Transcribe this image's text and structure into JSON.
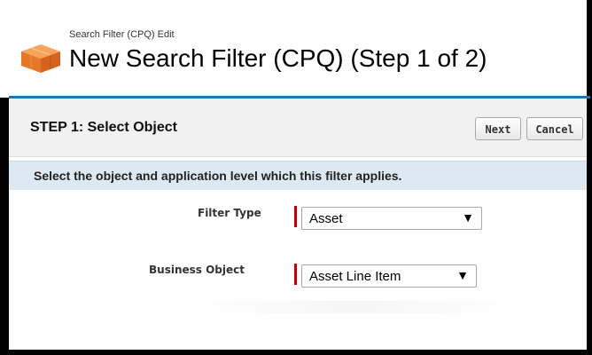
{
  "header": {
    "subtitle": "Search Filter (CPQ) Edit",
    "title": "New Search Filter (CPQ) (Step 1 of 2)",
    "icon": "crate-icon",
    "accent_color": "#1f78b4"
  },
  "step": {
    "title": "STEP 1: Select Object",
    "buttons": {
      "next": "Next",
      "cancel": "Cancel"
    }
  },
  "info": {
    "text": "Select the object and application level which this filter applies."
  },
  "fields": {
    "filter_type": {
      "label": "Filter Type",
      "value": "Asset",
      "required": true
    },
    "business_object": {
      "label": "Business Object",
      "value": "Asset Line Item",
      "required": true
    }
  },
  "colors": {
    "required_marker": "#c00000",
    "info_bar": "#dce9f3"
  }
}
